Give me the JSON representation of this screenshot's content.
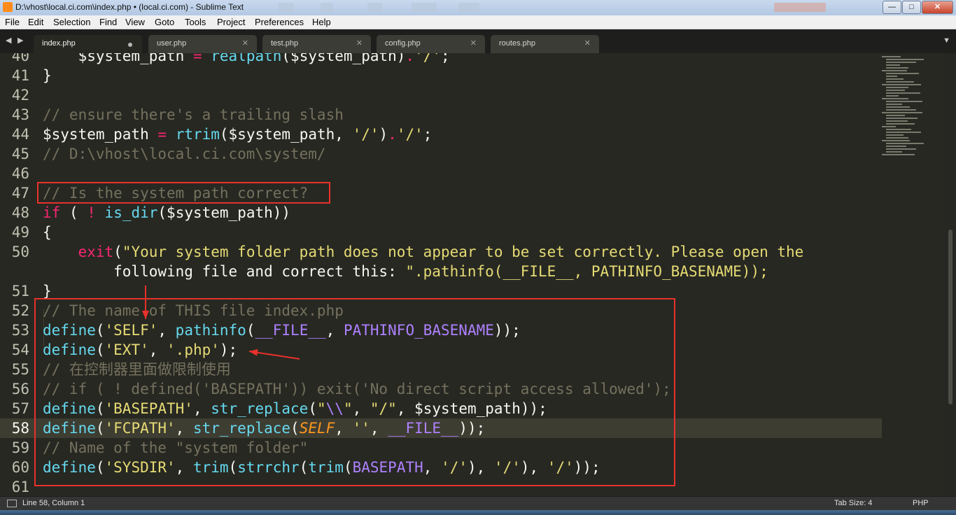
{
  "window": {
    "title": "D:\\vhost\\local.ci.com\\index.php • (local.ci.com) - Sublime Text",
    "minimize_label": "—",
    "maximize_label": "□",
    "close_label": "✕"
  },
  "menu": [
    "File",
    "Edit",
    "Selection",
    "Find",
    "View",
    "Goto",
    "Tools",
    "Project",
    "Preferences",
    "Help"
  ],
  "tabs": [
    {
      "label": "index.php",
      "active": true,
      "dirty": true
    },
    {
      "label": "user.php",
      "active": false
    },
    {
      "label": "test.php",
      "active": false
    },
    {
      "label": "config.php",
      "active": false
    },
    {
      "label": "routes.php",
      "active": false
    }
  ],
  "tab_close_glyph": "✕",
  "nav_left": "◀",
  "nav_right": "▶",
  "tab_menu_arrow": "▼",
  "editor": {
    "current_line": 58,
    "lines": [
      {
        "n": "40",
        "code": "    $system_path = realpath($system_path).'/';"
      },
      {
        "n": "41",
        "code": "}"
      },
      {
        "n": "42",
        "code": ""
      },
      {
        "n": "43",
        "code": "// ensure there's a trailing slash"
      },
      {
        "n": "44",
        "code": "$system_path = rtrim($system_path, '/').'/';"
      },
      {
        "n": "45",
        "code": "// D:\\vhost\\local.ci.com\\system/"
      },
      {
        "n": "46",
        "code": ""
      },
      {
        "n": "47",
        "code": "// Is the system path correct?"
      },
      {
        "n": "48",
        "code": "if ( ! is_dir($system_path))"
      },
      {
        "n": "49",
        "code": "{"
      },
      {
        "n": "50",
        "code": "    exit(\"Your system folder path does not appear to be set correctly. Please open the"
      },
      {
        "n": "",
        "code": "        following file and correct this: \".pathinfo(__FILE__, PATHINFO_BASENAME));"
      },
      {
        "n": "51",
        "code": "}"
      },
      {
        "n": "52",
        "code": "// The name of THIS file index.php"
      },
      {
        "n": "53",
        "code": "define('SELF', pathinfo(__FILE__, PATHINFO_BASENAME));"
      },
      {
        "n": "54",
        "code": "define('EXT', '.php');"
      },
      {
        "n": "55",
        "code": "// 在控制器里面做限制使用"
      },
      {
        "n": "56",
        "code": "// if ( ! defined('BASEPATH')) exit('No direct script access allowed');"
      },
      {
        "n": "57",
        "code": "define('BASEPATH', str_replace(\"\\\\\", \"/\", $system_path));"
      },
      {
        "n": "58",
        "code": "define('FCPATH', str_replace(SELF, '', __FILE__));"
      },
      {
        "n": "59",
        "code": "// Name of the \"system folder\""
      },
      {
        "n": "60",
        "code": "define('SYSDIR', trim(strrchr(trim(BASEPATH, '/'), '/'), '/'));"
      },
      {
        "n": "61",
        "code": ""
      }
    ]
  },
  "status": {
    "position": "Line 58, Column 1",
    "tab_size": "Tab Size: 4",
    "syntax": "PHP"
  },
  "colors": {
    "background": "#272822",
    "comment": "#75715e",
    "keyword": "#f92672",
    "function": "#66d9ef",
    "string": "#e6db74",
    "constant": "#ae81ff",
    "annotation": "#e8312c"
  }
}
